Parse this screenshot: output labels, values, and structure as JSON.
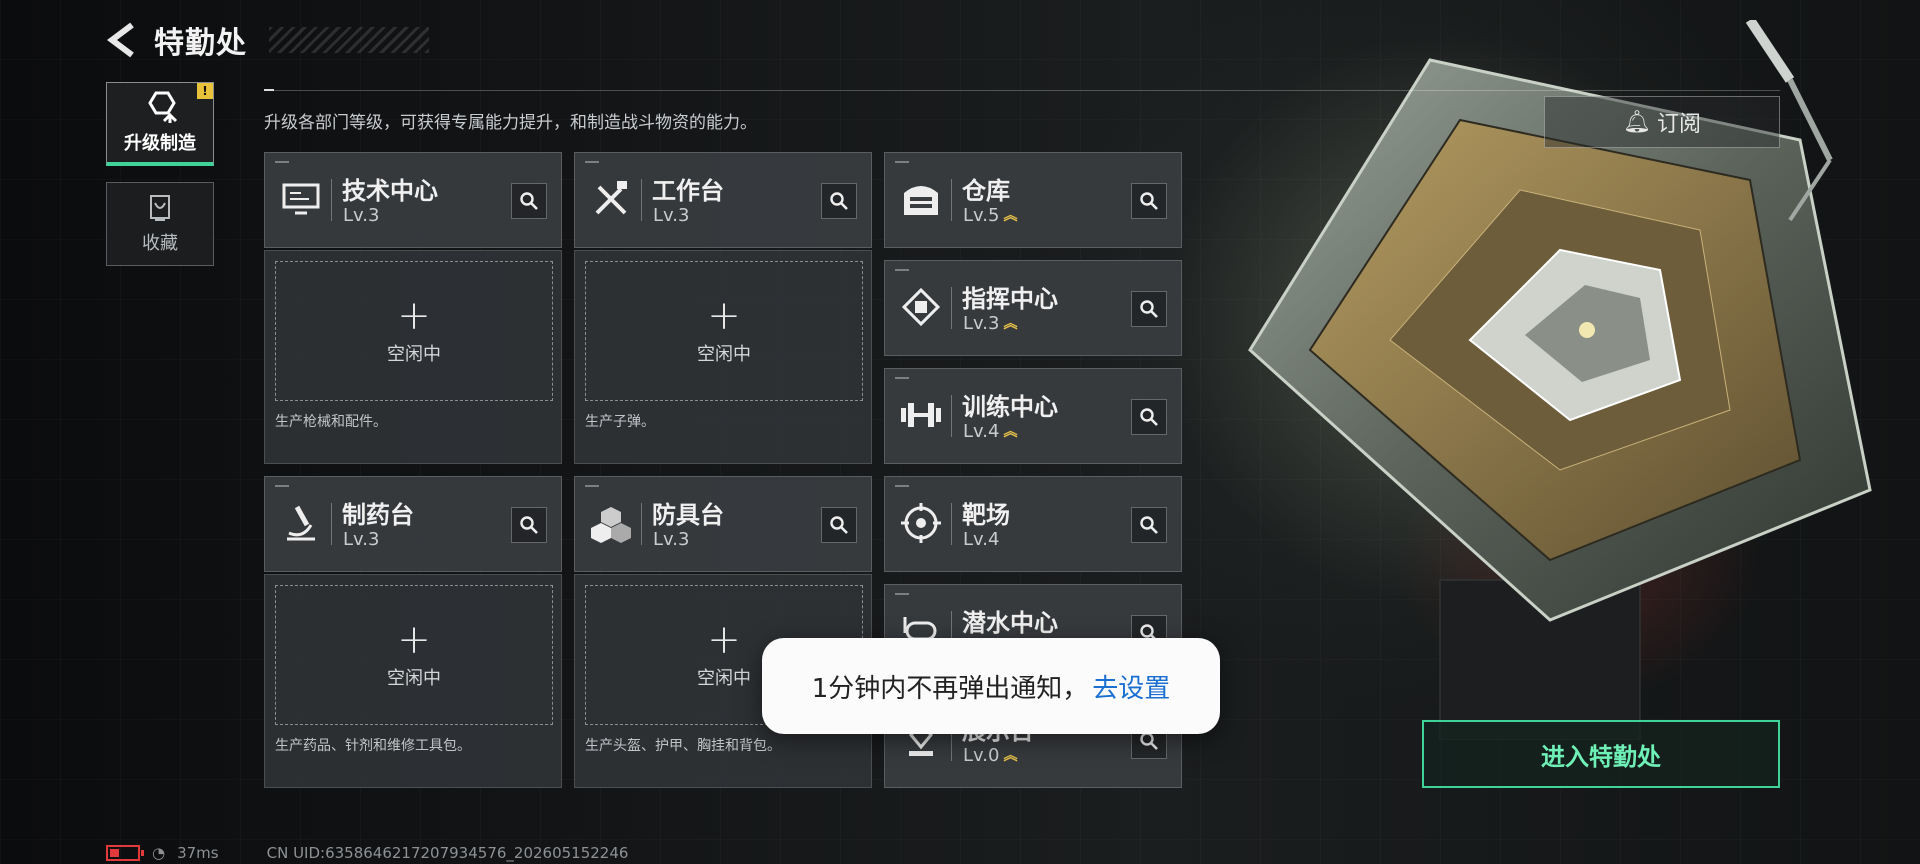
{
  "header": {
    "title": "特勤处"
  },
  "sidebar": {
    "tabs": [
      {
        "label": "升级制造",
        "active": true,
        "badge": "!"
      },
      {
        "label": "收藏",
        "active": false
      }
    ]
  },
  "description": "升级各部门等级，可获得专属能力提升，和制造战斗物资的能力。",
  "subscribe_label": "订阅",
  "production_departments": [
    {
      "name": "技术中心",
      "level": "Lv.3",
      "slot_label": "空闲中",
      "note": "生产枪械和配件。",
      "icon": "monitor-icon"
    },
    {
      "name": "工作台",
      "level": "Lv.3",
      "slot_label": "空闲中",
      "note": "生产子弹。",
      "icon": "tools-icon"
    },
    {
      "name": "制药台",
      "level": "Lv.3",
      "slot_label": "空闲中",
      "note": "生产药品、针剂和维修工具包。",
      "icon": "microscope-icon"
    },
    {
      "name": "防具台",
      "level": "Lv.3",
      "slot_label": "空闲中",
      "note": "生产头盔、护甲、胸挂和背包。",
      "icon": "armor-blocks-icon"
    }
  ],
  "facilities": [
    {
      "name": "仓库",
      "level": "Lv.5",
      "upgradable": true,
      "icon": "garage-icon"
    },
    {
      "name": "指挥中心",
      "level": "Lv.3",
      "upgradable": true,
      "icon": "chip-icon"
    },
    {
      "name": "训练中心",
      "level": "Lv.4",
      "upgradable": true,
      "icon": "dumbbell-icon"
    },
    {
      "name": "靶场",
      "level": "Lv.4",
      "upgradable": false,
      "icon": "target-icon"
    },
    {
      "name": "潜水中心",
      "level": "",
      "upgradable": true,
      "icon": "diving-icon"
    },
    {
      "name": "展示台",
      "level": "Lv.0",
      "upgradable": true,
      "icon": "display-stand-icon"
    }
  ],
  "enter_button": "进入特勤处",
  "toast": {
    "message": "1分钟内不再弹出通知，",
    "link": "去设置"
  },
  "status": {
    "battery_level": 0.3,
    "ping": "37ms",
    "uid": "CN UID:6358646217207934576_202605152246"
  },
  "colors": {
    "accent": "#3fd39a",
    "upgrade": "#e6c04a",
    "toast_link": "#1a6fd1",
    "battery": "#e23a3a"
  }
}
